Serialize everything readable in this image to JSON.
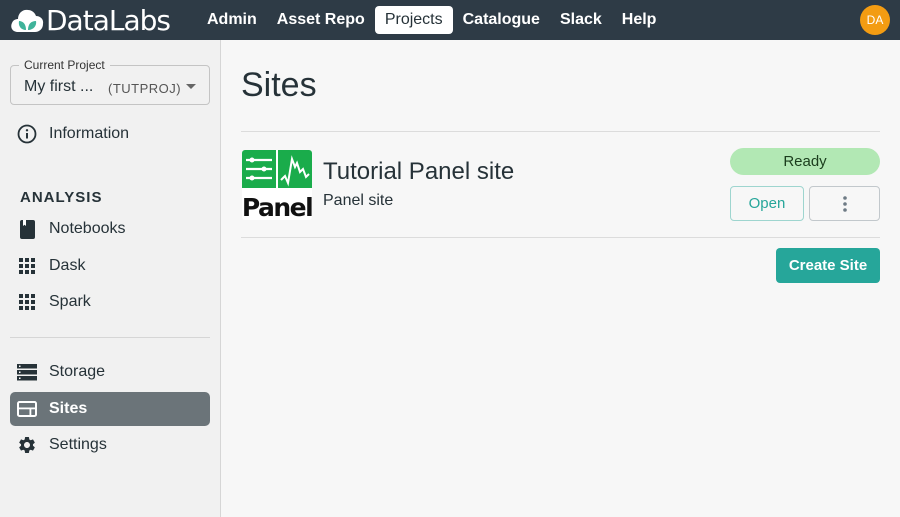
{
  "app": {
    "name": "DataLabs"
  },
  "topnav": {
    "items": [
      {
        "label": "Admin",
        "active": false
      },
      {
        "label": "Asset Repo",
        "active": false
      },
      {
        "label": "Projects",
        "active": true
      },
      {
        "label": "Catalogue",
        "active": false
      },
      {
        "label": "Slack",
        "active": false
      },
      {
        "label": "Help",
        "active": false
      }
    ],
    "user_initials": "DA"
  },
  "sidebar": {
    "project_selector": {
      "legend": "Current Project",
      "name": "My first ...",
      "key": "(TUTPROJ)"
    },
    "information": {
      "label": "Information",
      "icon": "info-icon"
    },
    "section_title": "ANALYSIS",
    "analysis_items": [
      {
        "label": "Notebooks",
        "icon": "notebook-icon"
      },
      {
        "label": "Dask",
        "icon": "grid-icon"
      },
      {
        "label": "Spark",
        "icon": "grid-icon"
      }
    ],
    "bottom_items": [
      {
        "label": "Storage",
        "icon": "storage-icon",
        "active": false
      },
      {
        "label": "Sites",
        "icon": "web-icon",
        "active": true
      },
      {
        "label": "Settings",
        "icon": "gear-icon",
        "active": false
      }
    ]
  },
  "main": {
    "title": "Sites",
    "sites": [
      {
        "title": "Tutorial Panel site",
        "type": "Panel site",
        "logo_text": "Panel",
        "status": "Ready",
        "open_label": "Open"
      }
    ],
    "create_label": "Create Site"
  },
  "colors": {
    "topbar": "#2e3b46",
    "accent": "#26a69a",
    "ready": "#b2e8b4",
    "avatar": "#f39c12",
    "active_sidebar": "#6b7479",
    "panel_green": "#1aac4b"
  }
}
